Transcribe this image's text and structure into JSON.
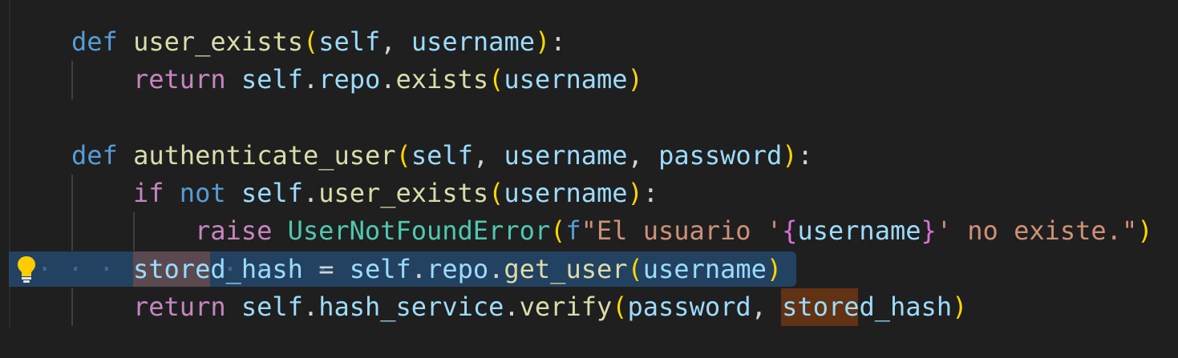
{
  "editor": {
    "lines": [
      {
        "tokens": [
          {
            "t": "def",
            "c": "kw-def"
          },
          {
            "t": " ",
            "c": "op"
          },
          {
            "t": "user_exists",
            "c": "fn"
          },
          {
            "t": "(",
            "c": "br1"
          },
          {
            "t": "self",
            "c": "var"
          },
          {
            "t": ", ",
            "c": "op"
          },
          {
            "t": "username",
            "c": "var"
          },
          {
            "t": ")",
            "c": "br1"
          },
          {
            "t": ":",
            "c": "op"
          }
        ]
      },
      {
        "tokens": [
          {
            "t": "return",
            "c": "kw-ctrl"
          },
          {
            "t": " ",
            "c": "op"
          },
          {
            "t": "self",
            "c": "var"
          },
          {
            "t": ".",
            "c": "op"
          },
          {
            "t": "repo",
            "c": "var"
          },
          {
            "t": ".",
            "c": "op"
          },
          {
            "t": "exists",
            "c": "fn"
          },
          {
            "t": "(",
            "c": "br1"
          },
          {
            "t": "username",
            "c": "var"
          },
          {
            "t": ")",
            "c": "br1"
          }
        ]
      },
      {
        "tokens": []
      },
      {
        "tokens": [
          {
            "t": "def",
            "c": "kw-def"
          },
          {
            "t": " ",
            "c": "op"
          },
          {
            "t": "authenticate_user",
            "c": "fn"
          },
          {
            "t": "(",
            "c": "br1"
          },
          {
            "t": "self",
            "c": "var"
          },
          {
            "t": ", ",
            "c": "op"
          },
          {
            "t": "username",
            "c": "var"
          },
          {
            "t": ", ",
            "c": "op"
          },
          {
            "t": "password",
            "c": "var"
          },
          {
            "t": ")",
            "c": "br1"
          },
          {
            "t": ":",
            "c": "op"
          }
        ]
      },
      {
        "tokens": [
          {
            "t": "if",
            "c": "kw-ctrl"
          },
          {
            "t": " ",
            "c": "op"
          },
          {
            "t": "not",
            "c": "kw-blue"
          },
          {
            "t": " ",
            "c": "op"
          },
          {
            "t": "self",
            "c": "var"
          },
          {
            "t": ".",
            "c": "op"
          },
          {
            "t": "user_exists",
            "c": "fn"
          },
          {
            "t": "(",
            "c": "br1"
          },
          {
            "t": "username",
            "c": "var"
          },
          {
            "t": ")",
            "c": "br1"
          },
          {
            "t": ":",
            "c": "op"
          }
        ]
      },
      {
        "tokens": [
          {
            "t": "raise",
            "c": "kw-ctrl"
          },
          {
            "t": " ",
            "c": "op"
          },
          {
            "t": "UserNotFoundError",
            "c": "cls"
          },
          {
            "t": "(",
            "c": "br1"
          },
          {
            "t": "f",
            "c": "strpre"
          },
          {
            "t": "\"El usuario '",
            "c": "str"
          },
          {
            "t": "{",
            "c": "br2"
          },
          {
            "t": "username",
            "c": "var"
          },
          {
            "t": "}",
            "c": "br2"
          },
          {
            "t": "' no existe.\"",
            "c": "str"
          },
          {
            "t": ")",
            "c": "br1"
          }
        ]
      },
      {
        "tokens": [
          {
            "t": "stored_hash",
            "c": "var"
          },
          {
            "t": " = ",
            "c": "op"
          },
          {
            "t": "self",
            "c": "var"
          },
          {
            "t": ".",
            "c": "op"
          },
          {
            "t": "repo",
            "c": "var"
          },
          {
            "t": ".",
            "c": "op"
          },
          {
            "t": "get_user",
            "c": "fn"
          },
          {
            "t": "(",
            "c": "br1"
          },
          {
            "t": "username",
            "c": "var"
          },
          {
            "t": ")",
            "c": "br1"
          }
        ]
      },
      {
        "tokens": [
          {
            "t": "return",
            "c": "kw-ctrl"
          },
          {
            "t": " ",
            "c": "op"
          },
          {
            "t": "self",
            "c": "var"
          },
          {
            "t": ".",
            "c": "op"
          },
          {
            "t": "hash_service",
            "c": "var"
          },
          {
            "t": ".",
            "c": "op"
          },
          {
            "t": "verify",
            "c": "fn"
          },
          {
            "t": "(",
            "c": "br1"
          },
          {
            "t": "password",
            "c": "var"
          },
          {
            "t": ", ",
            "c": "op"
          },
          {
            "t": "stored_hash",
            "c": "var"
          },
          {
            "t": ")",
            "c": "br1"
          }
        ]
      }
    ],
    "lightbulb_icon": "lightbulb-icon",
    "colors": {
      "background": "#1f1f1f",
      "current_line": "#264f78",
      "keyword": "#569cd6",
      "control": "#c586c0",
      "function": "#dcdcaa",
      "variable": "#9cdcfe",
      "class": "#4ec9b0",
      "string": "#ce9178",
      "bracket": "#ffd700",
      "bracket_inner": "#da70d6"
    }
  }
}
